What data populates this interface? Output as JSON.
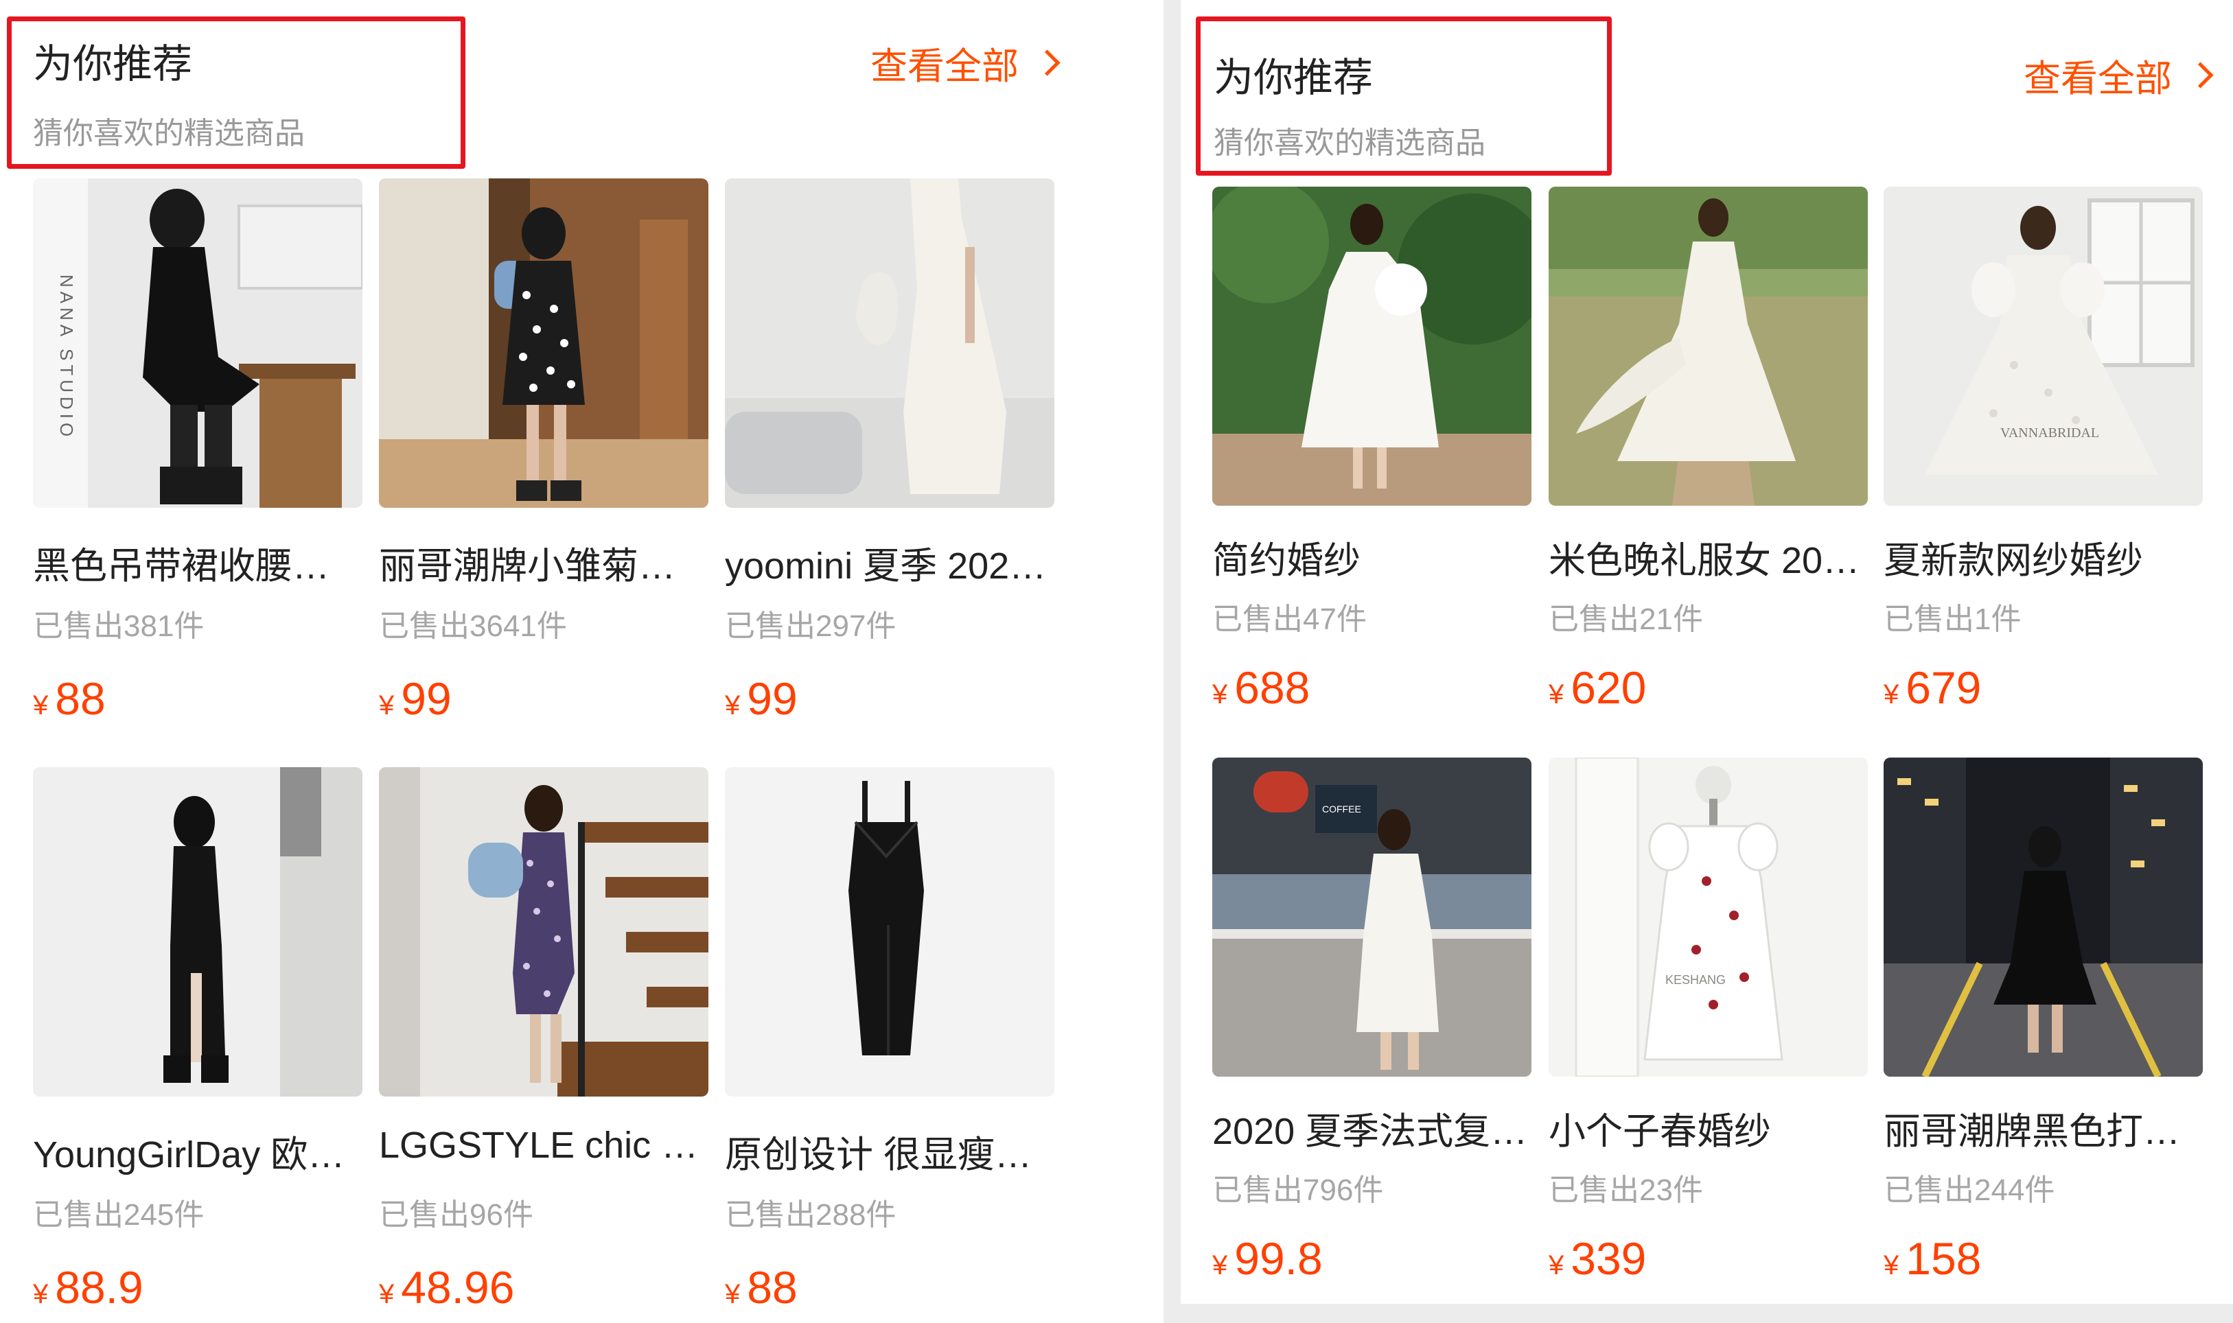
{
  "left": {
    "header": {
      "title": "为你推荐",
      "subtitle": "猜你喜欢的精选商品",
      "view_all": "查看全部"
    },
    "products": [
      {
        "title": "黑色吊带裙收腰…",
        "sold": "已售出381件",
        "currency": "¥",
        "price": "88",
        "thumb_text": "NANA STUDIO"
      },
      {
        "title": "丽哥潮牌小雏菊…",
        "sold": "已售出3641件",
        "currency": "¥",
        "price": "99"
      },
      {
        "title": "yoomini 夏季 202…",
        "sold": "已售出297件",
        "currency": "¥",
        "price": "99"
      },
      {
        "title": "YoungGirlDay 欧…",
        "sold": "已售出245件",
        "currency": "¥",
        "price": "88.9"
      },
      {
        "title": "LGGSTYLE chic …",
        "sold": "已售出96件",
        "currency": "¥",
        "price": "48.96"
      },
      {
        "title": "原创设计 很显瘦…",
        "sold": "已售出288件",
        "currency": "¥",
        "price": "88"
      }
    ]
  },
  "right": {
    "header": {
      "title": "为你推荐",
      "subtitle": "猜你喜欢的精选商品",
      "view_all": "查看全部"
    },
    "products": [
      {
        "title": "简约婚纱",
        "sold": "已售出47件",
        "currency": "¥",
        "price": "688"
      },
      {
        "title": "米色晚礼服女 201…",
        "sold": "已售出21件",
        "currency": "¥",
        "price": "620"
      },
      {
        "title": "夏新款网纱婚纱",
        "sold": "已售出1件",
        "currency": "¥",
        "price": "679",
        "thumb_text": "VANNABRIDAL"
      },
      {
        "title": "2020 夏季法式复…",
        "sold": "已售出796件",
        "currency": "¥",
        "price": "99.8",
        "thumb_text": "COFFEE"
      },
      {
        "title": "小个子春婚纱",
        "sold": "已售出23件",
        "currency": "¥",
        "price": "339",
        "thumb_text": "KESHANG"
      },
      {
        "title": "丽哥潮牌黑色打…",
        "sold": "已售出244件",
        "currency": "¥",
        "price": "158"
      }
    ]
  },
  "colors": {
    "accent": "#ff5000",
    "price": "#ff4000",
    "highlight_box": "#e5161f",
    "muted": "#999999"
  }
}
